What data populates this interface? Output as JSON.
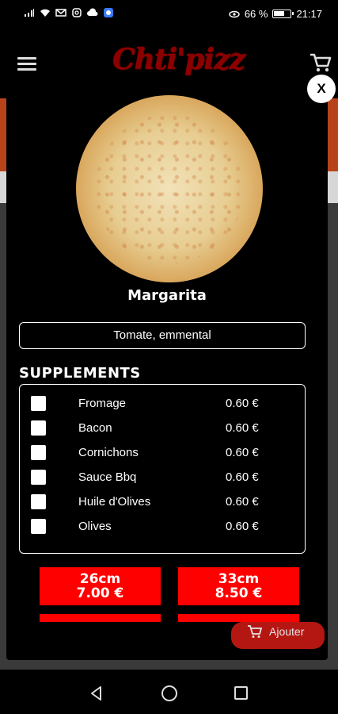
{
  "status_bar": {
    "battery": "66 %",
    "time": "21:17"
  },
  "app": {
    "logo_text": "Chti'pizz",
    "brand_color": "#ff0000"
  },
  "modal": {
    "close_label": "X",
    "pizza_name": "Margarita",
    "ingredients": "Tomate, emmental",
    "supplements_title": "SUPPLEMENTS",
    "supplements": [
      {
        "label": "Fromage",
        "price": "0.60 €",
        "checked": false
      },
      {
        "label": "Bacon",
        "price": "0.60 €",
        "checked": false
      },
      {
        "label": "Cornichons",
        "price": "0.60 €",
        "checked": false
      },
      {
        "label": "Sauce Bbq",
        "price": "0.60 €",
        "checked": false
      },
      {
        "label": "Huile d'Olives",
        "price": "0.60 €",
        "checked": false
      },
      {
        "label": "Olives",
        "price": "0.60 €",
        "checked": false
      }
    ],
    "sizes": [
      {
        "size": "26cm",
        "price": "7.00 €"
      },
      {
        "size": "33cm",
        "price": "8.50 €"
      }
    ]
  },
  "add_button": {
    "label": "Ajouter"
  }
}
